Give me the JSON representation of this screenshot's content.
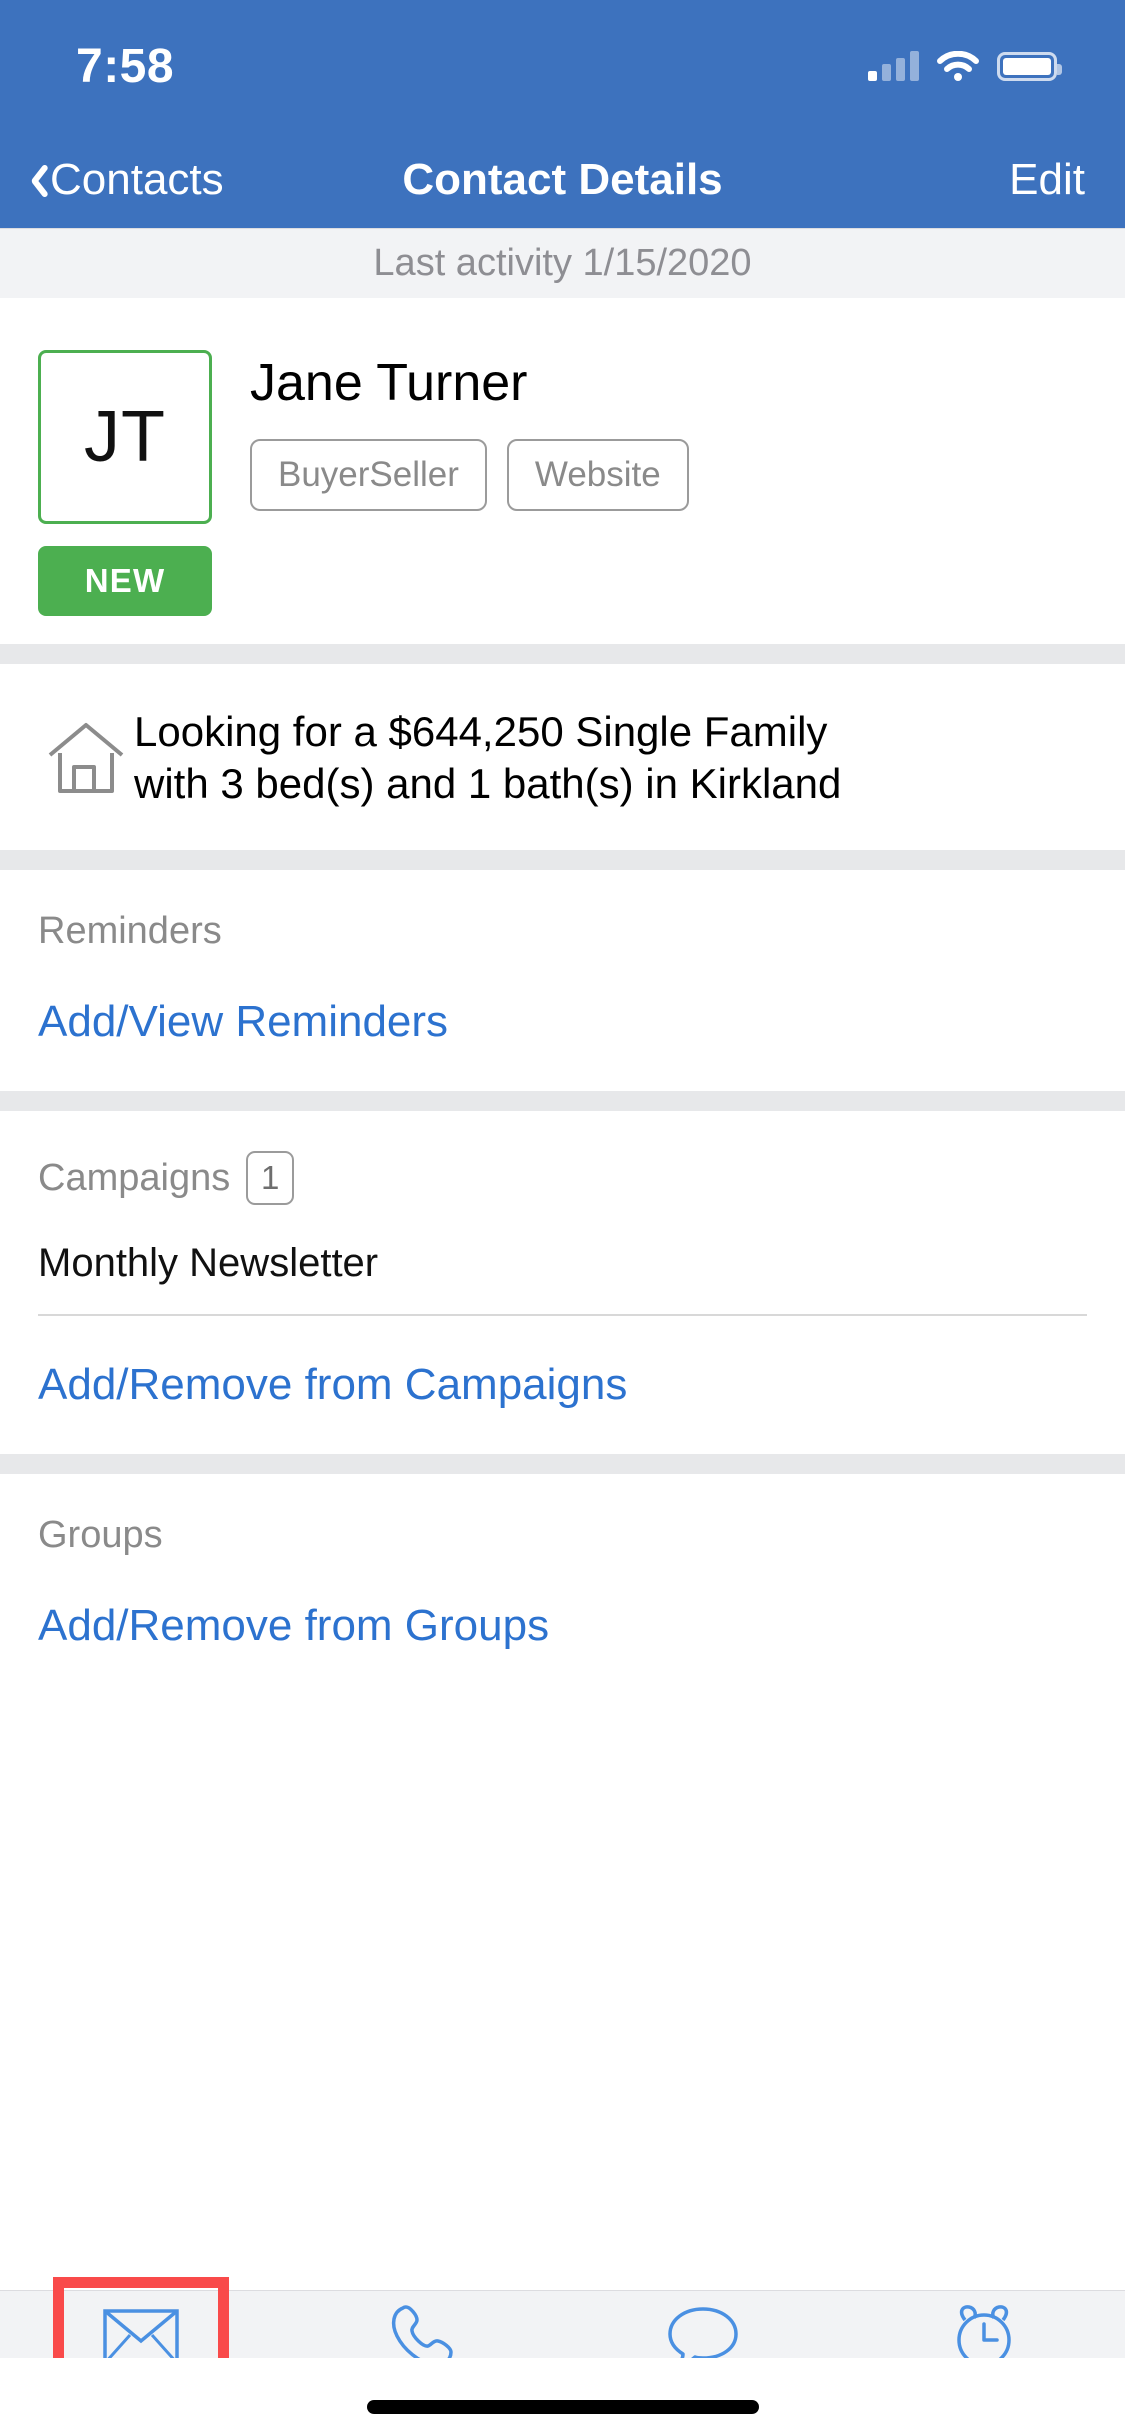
{
  "status_bar": {
    "time": "7:58",
    "signal_icon": "cellular-signal-icon",
    "wifi_icon": "wifi-icon",
    "battery_icon": "battery-full-icon"
  },
  "nav": {
    "back_icon": "chevron-left-icon",
    "back_label": "Contacts",
    "title": "Contact Details",
    "edit_label": "Edit"
  },
  "last_activity": {
    "text": "Last activity 1/15/2020"
  },
  "contact": {
    "avatar_initials": "JT",
    "avatar_icon": "avatar-initials-box",
    "status_badge": "NEW",
    "name": "Jane Turner",
    "tags": [
      {
        "label": "BuyerSeller"
      },
      {
        "label": "Website"
      }
    ]
  },
  "criteria": {
    "icon": "house-icon",
    "line1": "Looking for a $644,250 Single Family",
    "line2": "with 3 bed(s) and 1 bath(s) in Kirkland"
  },
  "reminders": {
    "label": "Reminders",
    "link": "Add/View Reminders"
  },
  "campaigns": {
    "label": "Campaigns",
    "count": "1",
    "items": [
      {
        "name": "Monthly Newsletter"
      }
    ],
    "link": "Add/Remove from Campaigns"
  },
  "groups": {
    "label": "Groups",
    "link": "Add/Remove from Groups"
  },
  "tabbar": {
    "tabs": [
      {
        "label": "Email",
        "icon": "envelope-icon",
        "highlighted": true
      },
      {
        "label": "Phone",
        "icon": "phone-icon",
        "highlighted": false
      },
      {
        "label": "Text",
        "icon": "chat-bubble-icon",
        "highlighted": false
      },
      {
        "label": "Reminder",
        "icon": "alarm-clock-icon",
        "highlighted": false
      }
    ]
  },
  "colors": {
    "nav_blue": "#3D72BE",
    "link_blue": "#2C72CF",
    "accent_green": "#4CAF50",
    "highlight_red": "#F94A4A",
    "section_gap": "#E7E8EA"
  }
}
